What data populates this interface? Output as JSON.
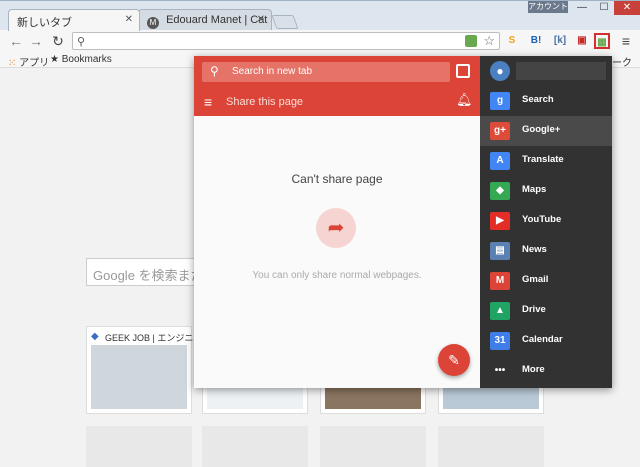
{
  "browser": {
    "tabs": [
      {
        "title": "新しいタブ",
        "active": true
      },
      {
        "title": "Edouard Manet | Cat an",
        "favicon": "M",
        "active": false
      }
    ],
    "account_label": "アカウント"
  },
  "bookmarks_bar": {
    "apps_label": "アプリ",
    "bookmarks_label": "Bookmarks",
    "right_label": "マーク"
  },
  "extensions": [
    {
      "name": "chrome-icon",
      "glyph": "S",
      "color": "#f4a01c"
    },
    {
      "name": "hatena-bookmark-icon",
      "glyph": "B!",
      "color": "#1a5fb4"
    },
    {
      "name": "hatena-icon",
      "glyph": "[k]",
      "color": "#4a6fa5"
    },
    {
      "name": "flag-icon",
      "glyph": "▣",
      "color": "#c62828"
    },
    {
      "name": "google-apps-launcher-icon",
      "glyph": "▦",
      "color": "#6aa84f"
    }
  ],
  "ntp": {
    "search_placeholder": "Google を検索または",
    "tile_title": "GEEK JOB | エンジニア"
  },
  "popup": {
    "search_placeholder": "Search in new tab",
    "share_title": "Share this page",
    "cant_share": "Can't share page",
    "only_normal": "You can only share normal webpages.",
    "apps": [
      {
        "label": "Search",
        "icon": "search-icon",
        "glyph": "g",
        "color": "#4285f4"
      },
      {
        "label": "Google+",
        "icon": "google-plus-icon",
        "glyph": "g+",
        "color": "#dd4b39"
      },
      {
        "label": "Translate",
        "icon": "translate-icon",
        "glyph": "A",
        "color": "#4285f4"
      },
      {
        "label": "Maps",
        "icon": "maps-icon",
        "glyph": "◆",
        "color": "#34a853"
      },
      {
        "label": "YouTube",
        "icon": "youtube-icon",
        "glyph": "▶",
        "color": "#e52d27"
      },
      {
        "label": "News",
        "icon": "news-icon",
        "glyph": "▤",
        "color": "#5b80b2"
      },
      {
        "label": "Gmail",
        "icon": "gmail-icon",
        "glyph": "M",
        "color": "#db4437"
      },
      {
        "label": "Drive",
        "icon": "drive-icon",
        "glyph": "▲",
        "color": "#1fa463"
      },
      {
        "label": "Calendar",
        "icon": "calendar-icon",
        "glyph": "31",
        "color": "#3f7ee8"
      },
      {
        "label": "More",
        "icon": "more-icon",
        "glyph": "•••",
        "color": "transparent"
      }
    ]
  }
}
